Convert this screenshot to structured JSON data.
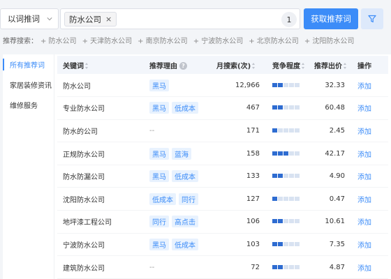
{
  "search": {
    "mode_label": "以词推词",
    "chip_text": "防水公司",
    "chip_close": "×",
    "count": "1",
    "fetch_label": "获取推荐词"
  },
  "recommend": {
    "label": "推荐搜索：",
    "items": [
      "+ 防水公司",
      "+ 天津防水公司",
      "+ 南京防水公司",
      "+ 宁波防水公司",
      "+ 北京防水公司",
      "+ 沈阳防水公司"
    ]
  },
  "sidebar": {
    "items": [
      {
        "label": "所有推荐词",
        "active": true
      },
      {
        "label": "家居装修资讯",
        "active": false
      },
      {
        "label": "维修服务",
        "active": false
      }
    ]
  },
  "table": {
    "headers": {
      "keyword": "关键词",
      "reason": "推荐理由",
      "monthly": "月搜索(次)",
      "competition": "竞争程度",
      "bid": "推荐出价",
      "action": "操作"
    },
    "rows": [
      {
        "keyword": "防水公司",
        "tags": [
          "黑马"
        ],
        "monthly": "12,966",
        "competition": 2,
        "bid": "32.33",
        "action": "添加"
      },
      {
        "keyword": "专业防水公司",
        "tags": [
          "黑马",
          "低成本"
        ],
        "monthly": "467",
        "competition": 2,
        "bid": "60.48",
        "action": "添加"
      },
      {
        "keyword": "防水的公司",
        "tags": [],
        "dash": "--",
        "monthly": "171",
        "competition": 1,
        "bid": "2.45",
        "action": "添加"
      },
      {
        "keyword": "正规防水公司",
        "tags": [
          "黑马",
          "蓝海"
        ],
        "monthly": "158",
        "competition": 3,
        "bid": "42.17",
        "action": "添加"
      },
      {
        "keyword": "防水防漏公司",
        "tags": [
          "黑马",
          "低成本"
        ],
        "monthly": "133",
        "competition": 2,
        "bid": "4.90",
        "action": "添加"
      },
      {
        "keyword": "沈阳防水公司",
        "tags": [
          "低成本",
          "同行"
        ],
        "monthly": "127",
        "competition": 1,
        "bid": "0.47",
        "action": "添加"
      },
      {
        "keyword": "地坪漆工程公司",
        "tags": [
          "同行",
          "高点击"
        ],
        "monthly": "106",
        "competition": 2,
        "bid": "10.61",
        "action": "添加"
      },
      {
        "keyword": "宁波防水公司",
        "tags": [
          "黑马",
          "低成本"
        ],
        "monthly": "103",
        "competition": 2,
        "bid": "7.35",
        "action": "添加"
      },
      {
        "keyword": "建筑防水公司",
        "tags": [],
        "dash": "--",
        "monthly": "72",
        "competition": 2,
        "bid": "4.87",
        "action": "添加"
      }
    ]
  },
  "colors": {
    "accent": "#3c8cf8",
    "bar_on": "#2e6cd1",
    "bar_off": "#d8e2f1",
    "tag_bg": "#e8f2fe"
  },
  "icons": [
    "chevron-down-icon",
    "close-icon",
    "filter-icon",
    "help-icon",
    "sort-icon"
  ]
}
